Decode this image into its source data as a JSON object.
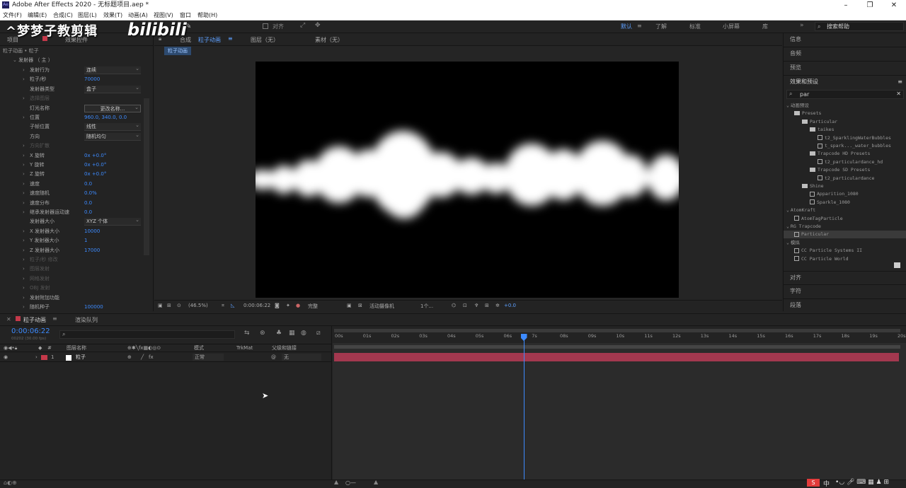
{
  "window": {
    "title": "Adobe After Effects 2020 - 无标题项目.aep *",
    "app_icon": "Ae"
  },
  "menu": [
    "文件(F)",
    "编辑(E)",
    "合成(C)",
    "图层(L)",
    "效果(T)",
    "动画(A)",
    "视图(V)",
    "窗口",
    "帮助(H)"
  ],
  "toolbar": {
    "snap_label": "对齐",
    "workspaces": [
      "默认",
      "了解",
      "标准",
      "小屏幕",
      "库"
    ],
    "active_workspace": "默认",
    "search_placeholder": "搜索帮助"
  },
  "watermark": {
    "text": "^梦梦子教剪辑",
    "logo": "bilibili"
  },
  "left_panel": {
    "tab_project": "项目",
    "tab_effects": "效果控件",
    "breadcrumb": "粒子动画 • 粒子",
    "section": "发射器  （ 主 ）",
    "rows": [
      {
        "label": "发射行为",
        "value": "连续",
        "type": "dropdown"
      },
      {
        "label": "粒子/秒",
        "value": "70000",
        "type": "value"
      },
      {
        "label": "发射器类型",
        "value": "盒子",
        "type": "dropdown"
      },
      {
        "label": "选择图层",
        "value": "",
        "type": "dim"
      },
      {
        "label": "灯光名称",
        "value": "更改名称...",
        "type": "button"
      },
      {
        "label": "位置",
        "value": "960.0, 340.0, 0.0",
        "type": "value"
      },
      {
        "label": "子帧位置",
        "value": "线性",
        "type": "dropdown"
      },
      {
        "label": "方向",
        "value": "随机均匀",
        "type": "dropdown"
      },
      {
        "label": "方向扩散",
        "value": "",
        "type": "dim"
      },
      {
        "label": "X 旋转",
        "value": "0x +0.0°",
        "type": "value"
      },
      {
        "label": "Y 旋转",
        "value": "0x +0.0°",
        "type": "value"
      },
      {
        "label": "Z 旋转",
        "value": "0x +0.0°",
        "type": "value"
      },
      {
        "label": "速度",
        "value": "0.0",
        "type": "value"
      },
      {
        "label": "速度随机",
        "value": "0.0%",
        "type": "value"
      },
      {
        "label": "速度分布",
        "value": "0.0",
        "type": "value"
      },
      {
        "label": "继承发射器运动速",
        "value": "0.0",
        "type": "value"
      },
      {
        "label": "发射器大小",
        "value": "XYZ 个体",
        "type": "dropdown"
      },
      {
        "label": "X 发射器大小",
        "value": "10000",
        "type": "value"
      },
      {
        "label": "Y 发射器大小",
        "value": "1",
        "type": "value"
      },
      {
        "label": "Z 发射器大小",
        "value": "17000",
        "type": "value"
      },
      {
        "label": "粒子/秒 修改",
        "value": "",
        "type": "dim"
      },
      {
        "label": "图层发射",
        "value": "",
        "type": "dim"
      },
      {
        "label": "网格发射",
        "value": "",
        "type": "dim"
      },
      {
        "label": "OBJ 发射",
        "value": "",
        "type": "dim"
      },
      {
        "label": "发射附加功能",
        "value": "",
        "type": "section"
      },
      {
        "label": "随机种子",
        "value": "100000",
        "type": "value"
      }
    ]
  },
  "comp": {
    "header_prefix": "合成",
    "tab": "粒子动画",
    "layer_panel": "图层（无）",
    "footage_panel": "素材（无）",
    "subtab": "粒子动画",
    "zoom": "(46.5%)",
    "time": "0:00:06:22",
    "quality": "完整",
    "camera": "活动摄像机",
    "views": "1个...",
    "exposure": "+0.0"
  },
  "right_panel": {
    "info": "信息",
    "audio": "音频",
    "preview": "预览",
    "effects_presets": "效果和预设",
    "search_value": "par",
    "tree": [
      {
        "label": "动画预设",
        "level": 0,
        "kind": "arrow"
      },
      {
        "label": "Presets",
        "level": 1,
        "kind": "folder"
      },
      {
        "label": "Particular",
        "level": 2,
        "kind": "folder"
      },
      {
        "label": "taikes",
        "level": 3,
        "kind": "folder"
      },
      {
        "label": "t2_SparklingWaterBubbles",
        "level": 4,
        "kind": "preset"
      },
      {
        "label": "t_spark..._water_bubbles",
        "level": 4,
        "kind": "preset"
      },
      {
        "label": "Trapcode HD Presets",
        "level": 3,
        "kind": "folder"
      },
      {
        "label": "t2_particulardance_hd",
        "level": 4,
        "kind": "preset"
      },
      {
        "label": "Trapcode SD Presets",
        "level": 3,
        "kind": "folder"
      },
      {
        "label": "t2_particulardance",
        "level": 4,
        "kind": "preset"
      },
      {
        "label": "Shine",
        "level": 2,
        "kind": "folder"
      },
      {
        "label": "Apparition_1080",
        "level": 3,
        "kind": "preset"
      },
      {
        "label": "Sparkle_1080",
        "level": 3,
        "kind": "preset"
      },
      {
        "label": "AtomKraft",
        "level": 0,
        "kind": "arrow"
      },
      {
        "label": "AtomTagParticle",
        "level": 1,
        "kind": "preset"
      },
      {
        "label": "RG Trapcode",
        "level": 0,
        "kind": "arrow"
      },
      {
        "label": "Particular",
        "level": 1,
        "kind": "preset",
        "selected": true
      },
      {
        "label": "模拟",
        "level": 0,
        "kind": "arrow"
      },
      {
        "label": "CC Particle Systems II",
        "level": 1,
        "kind": "preset"
      },
      {
        "label": "CC Particle World",
        "level": 1,
        "kind": "preset"
      }
    ],
    "align": "对齐",
    "character": "字符",
    "paragraph": "段落"
  },
  "timeline": {
    "tab_comp": "粒子动画",
    "tab_render": "渲染队列",
    "current_time": "0:00:06:22",
    "frame_info": "00202 (30.00 fps)",
    "search_placeholder": "",
    "columns": {
      "layer_name": "图层名称",
      "mode": "模式",
      "trkmat": "TrkMat",
      "parent": "父级和链接"
    },
    "layer": {
      "index": "1",
      "name": "粒子",
      "mode": "正常",
      "parent": "无",
      "color": "#c4394a"
    },
    "ruler": [
      "00s",
      "01s",
      "02s",
      "03s",
      "04s",
      "05s",
      "06s",
      "7s",
      "08s",
      "09s",
      "10s",
      "11s",
      "12s",
      "13s",
      "14s",
      "15s",
      "16s",
      "17s",
      "18s",
      "19s",
      "20s"
    ],
    "playhead_seconds": 6.73,
    "duration_seconds": 20
  },
  "statusbar": {
    "ime": "中"
  },
  "colors": {
    "accent": "#3d8bff",
    "layer_bar": "#a3384f",
    "label_red": "#c4394a",
    "bg": "#232323"
  }
}
